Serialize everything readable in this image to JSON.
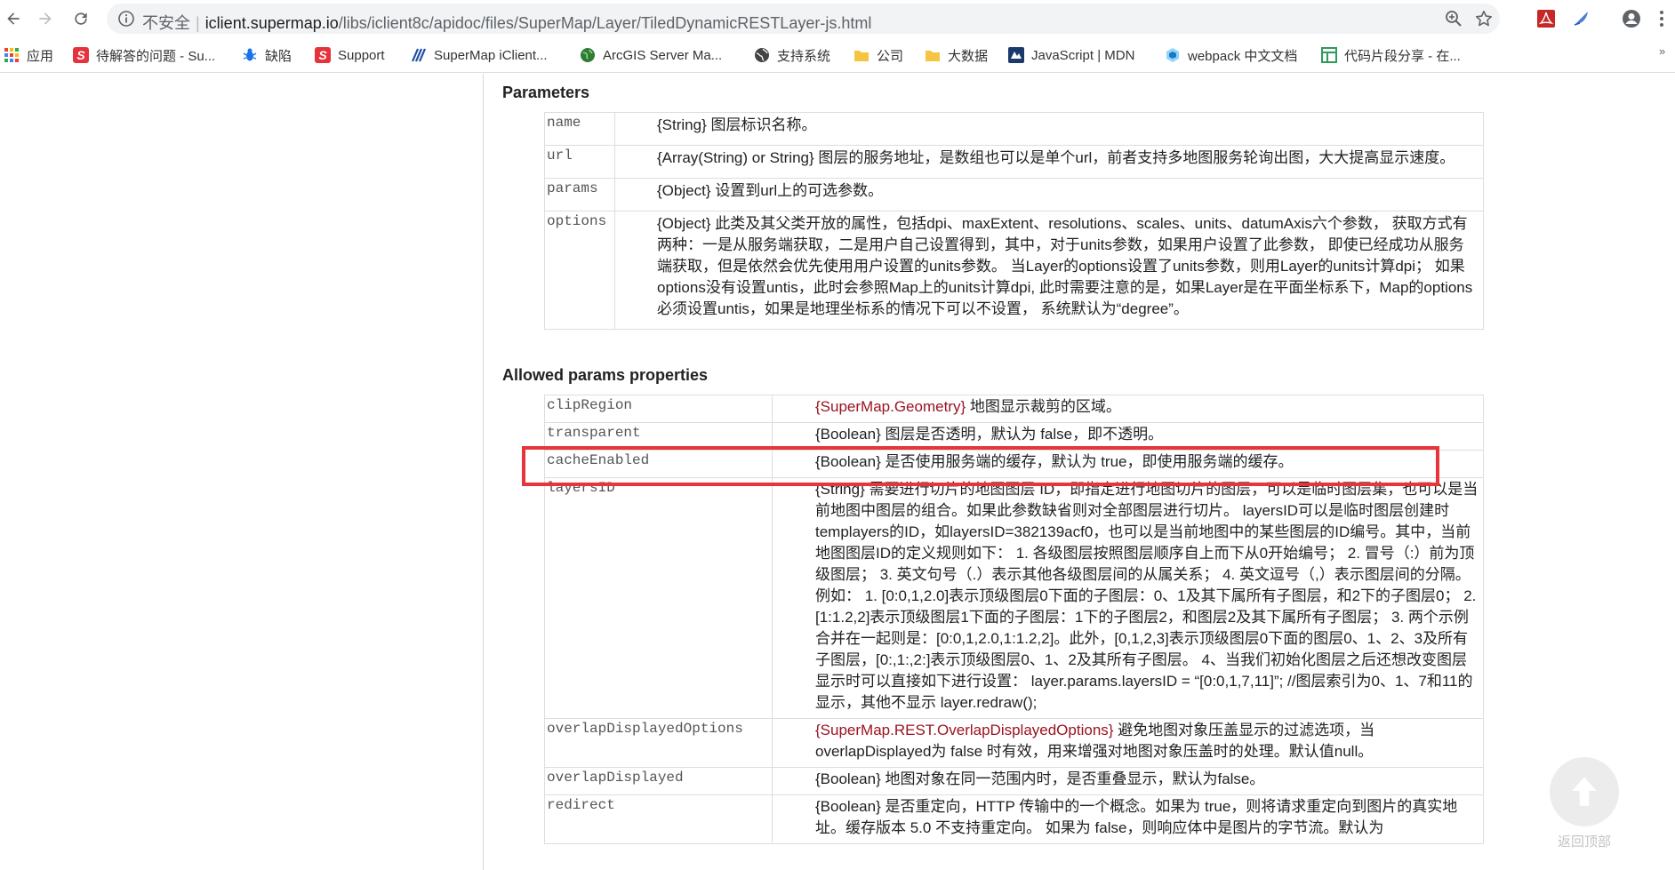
{
  "browser": {
    "security_label": "不安全",
    "url_host": "iclient.supermap.io",
    "url_path": "/libs/iclient8c/apidoc/files/SuperMap/Layer/TiledDynamicRESTLayer-js.html"
  },
  "bookmarks": [
    {
      "label": "应用",
      "icon": "apps-grid-icon",
      "color": "#e94235"
    },
    {
      "label": "待解答的问题 - Su...",
      "icon": "supermap-s-icon",
      "color": "#e5323b"
    },
    {
      "label": "缺陷",
      "icon": "bug-icon",
      "color": "#1a73e8"
    },
    {
      "label": "Support",
      "icon": "supermap-s-icon",
      "color": "#e5323b"
    },
    {
      "label": "SuperMap iClient...",
      "icon": "stripes-icon",
      "color": "#1e4fa3"
    },
    {
      "label": "ArcGIS Server Ma...",
      "icon": "globe-icon",
      "color": "#2e7d32"
    },
    {
      "label": "支持系统",
      "icon": "world-icon",
      "color": "#444444"
    },
    {
      "label": "公司",
      "icon": "folder-icon",
      "color": "#f5c542"
    },
    {
      "label": "大数据",
      "icon": "folder-icon",
      "color": "#f5c542"
    },
    {
      "label": "JavaScript | MDN",
      "icon": "mdn-icon",
      "color": "#1b3a6b"
    },
    {
      "label": "webpack 中文文档",
      "icon": "cube-icon",
      "color": "#2b7fd8"
    },
    {
      "label": "代码片段分享 - 在...",
      "icon": "table-icon",
      "color": "#2e9b5a"
    }
  ],
  "bookmarks_more": "»",
  "parameters": {
    "title": "Parameters",
    "rows": [
      {
        "name": "name",
        "type": "{String}",
        "desc": " 图层标识名称。"
      },
      {
        "name": "url",
        "type": "{Array(String) or String}",
        "desc": " 图层的服务地址，是数组也可以是单个url，前者支持多地图服务轮询出图，大大提高显示速度。"
      },
      {
        "name": "params",
        "type": "{Object}",
        "desc": " 设置到url上的可选参数。"
      },
      {
        "name": "options",
        "type": "{Object}",
        "desc": " 此类及其父类开放的属性，包括dpi、maxExtent、resolutions、scales、units、datumAxis六个参数， 获取方式有两种：一是从服务端获取，二是用户自己设置得到，其中，对于units参数，如果用户设置了此参数， 即使已经成功从服务端获取，但是依然会优先使用用户设置的units参数。 当Layer的options设置了units参数，则用Layer的units计算dpi； 如果options没有设置untis，此时会参照Map上的units计算dpi, 此时需要注意的是，如果Layer是在平面坐标系下，Map的options必须设置untis，如果是地理坐标系的情况下可以不设置， 系统默认为“degree”。"
      }
    ]
  },
  "allowed": {
    "title": "Allowed params properties",
    "rows": [
      {
        "name": "clipRegion",
        "type": "{SuperMap.Geometry}",
        "linked": true,
        "desc": " 地图显示裁剪的区域。"
      },
      {
        "name": "transparent",
        "type": "{Boolean}",
        "linked": false,
        "desc": " 图层是否透明，默认为 false，即不透明。"
      },
      {
        "name": "cacheEnabled",
        "type": "{Boolean}",
        "linked": false,
        "desc": " 是否使用服务端的缓存，默认为 true，即使用服务端的缓存。"
      },
      {
        "name": "layersID",
        "type": "{String}",
        "linked": false,
        "desc": " 需要进行切片的地图图层 ID，即指定进行地图切片的图层，可以是临时图层集，也可以是当前地图中图层的组合。如果此参数缺省则对全部图层进行切片。 layersID可以是临时图层创建时templayers的ID，如layersID=382139acf0，也可以是当前地图中的某些图层的ID编号。其中，当前地图图层ID的定义规则如下： 1. 各级图层按照图层顺序自上而下从0开始编号； 2. 冒号（:）前为顶级图层； 3. 英文句号（.）表示其他各级图层间的从属关系； 4. 英文逗号（,）表示图层间的分隔。 例如： 1. [0:0,1,2.0]表示顶级图层0下面的子图层：0、1及其下属所有子图层，和2下的子图层0； 2. [1:1.2,2]表示顶级图层1下面的子图层：1下的子图层2，和图层2及其下属所有子图层； 3. 两个示例合并在一起则是：[0:0,1,2.0,1:1.2,2]。此外，[0,1,2,3]表示顶级图层0下面的图层0、1、2、3及所有子图层，[0:,1:,2:]表示顶级图层0、1、2及其所有子图层。 4、当我们初始化图层之后还想改变图层显示时可以直接如下进行设置： layer.params.layersID = “[0:0,1,7,11]”; //图层索引为0、1、7和11的显示，其他不显示 layer.redraw();"
      },
      {
        "name": "overlapDisplayedOptions",
        "type": "{SuperMap.REST.OverlapDisplayedOptions}",
        "linked": true,
        "desc": " 避免地图对象压盖显示的过滤选项，当overlapDisplayed为 false 时有效，用来增强对地图对象压盖时的处理。默认值null。"
      },
      {
        "name": "overlapDisplayed",
        "type": "{Boolean}",
        "linked": false,
        "desc": " 地图对象在同一范围内时，是否重叠显示，默认为false。"
      },
      {
        "name": "redirect",
        "type": "{Boolean}",
        "linked": false,
        "desc": " 是否重定向，HTTP 传输中的一个概念。如果为 true，则将请求重定向到图片的真实地址。缓存版本 5.0 不支持重定向。 如果为 false，则响应体中是图片的字节流。默认为"
      }
    ]
  },
  "back_to_top": {
    "label": "返回顶部"
  },
  "colors": {
    "highlight": "#e8343a",
    "type_link": "#9b1321"
  }
}
